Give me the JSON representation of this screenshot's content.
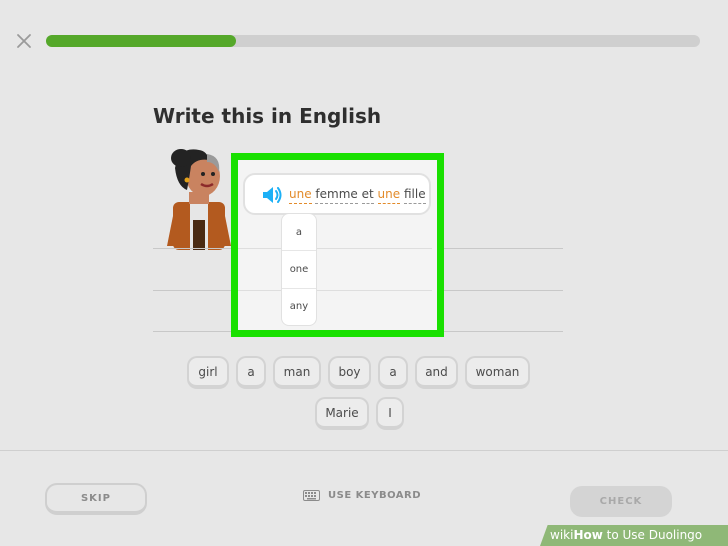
{
  "header": {
    "close_icon": "close-icon",
    "progress": 0.29
  },
  "prompt": {
    "title": "Write this in English"
  },
  "sentence": {
    "words": [
      {
        "text": "une",
        "highlighted": true
      },
      {
        "text": "femme",
        "highlighted": false
      },
      {
        "text": "et",
        "highlighted": false
      },
      {
        "text": "une",
        "highlighted": true
      },
      {
        "text": "fille",
        "highlighted": false
      }
    ],
    "speaker_icon": "speaker-icon"
  },
  "hints": [
    "a",
    "one",
    "any"
  ],
  "word_bank": {
    "row1": [
      "girl",
      "a",
      "man",
      "boy",
      "a",
      "and",
      "woman"
    ],
    "row2": [
      "Marie",
      "I"
    ]
  },
  "footer": {
    "skip_label": "SKIP",
    "keyboard_label": "USE KEYBOARD",
    "check_label": "CHECK"
  },
  "watermark": {
    "wiki": "wiki",
    "how": "How",
    "rest": " to Use Duolingo"
  },
  "colors": {
    "progress": "#55a82a",
    "highlight_border": "#19e000",
    "word_highlight": "#e38b2a",
    "speaker": "#1cb0f6"
  }
}
